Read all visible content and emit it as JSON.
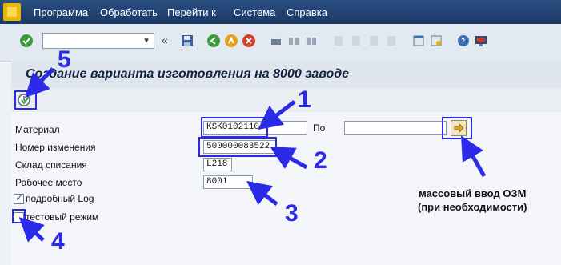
{
  "menu": {
    "items": [
      {
        "label": "Программа"
      },
      {
        "label": "Обработать"
      },
      {
        "label": "Перейти к"
      },
      {
        "label": "Система"
      },
      {
        "label": "Справка"
      }
    ]
  },
  "toolbar": {
    "command_field_value": "",
    "icons": [
      "enter-icon",
      "save-icon",
      "back-icon",
      "exit-icon",
      "cancel-icon",
      "print-icon",
      "find-icon",
      "find-next-icon",
      "first-page-icon",
      "prev-page-icon",
      "next-page-icon",
      "last-page-icon",
      "new-session-icon",
      "shortcut-icon",
      "help-icon",
      "layout-icon"
    ]
  },
  "page": {
    "title": "Создание варианта изготовления на 8000 заводе"
  },
  "form": {
    "material_label": "Материал",
    "material_value": "KSK0102110",
    "to_label": "По",
    "to_value": "",
    "change_number_label": "Номер изменения",
    "change_number_value": "500000083522",
    "storage_label": "Склад списания",
    "storage_value": "L218",
    "workplace_label": "Рабочее место",
    "workplace_value": "8001",
    "detailed_log_label": "подробный Log",
    "detailed_log_checked": true,
    "test_mode_label": "тестовый режим",
    "test_mode_checked": false
  },
  "annotations": {
    "n1": "1",
    "n2": "2",
    "n3": "3",
    "n4": "4",
    "n5": "5",
    "multi_input_line1": "массовый ввод ОЗМ",
    "multi_input_line2": "(при необходимости)",
    "color": "#2a2ae8"
  }
}
